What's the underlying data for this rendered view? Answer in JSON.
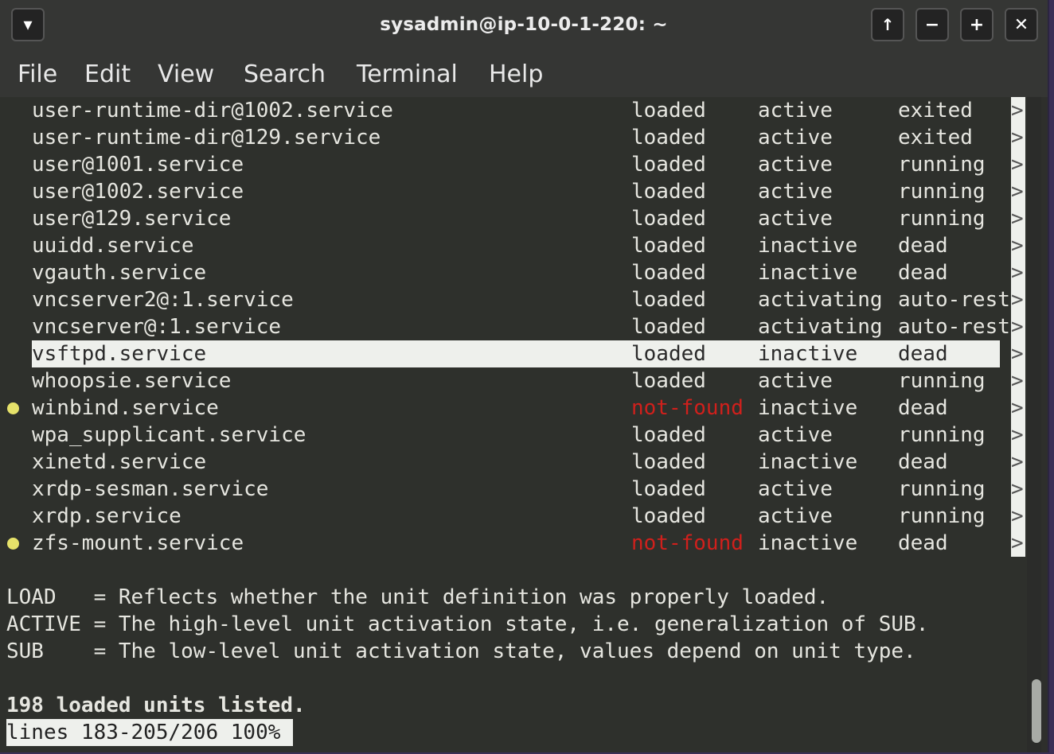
{
  "window": {
    "title": "sysadmin@ip-10-0-1-220: ~",
    "buttons": {
      "menu": "▾",
      "raise": "🡅",
      "minimize": "−",
      "maximize": "+",
      "close": "✕"
    }
  },
  "menubar": [
    "File",
    "Edit",
    "View",
    "Search",
    "Terminal",
    "Help"
  ],
  "units": [
    {
      "name": "user-runtime-dir@1002.service",
      "load": "loaded",
      "active": "active",
      "sub": "exited",
      "warn": false
    },
    {
      "name": "user-runtime-dir@129.service",
      "load": "loaded",
      "active": "active",
      "sub": "exited",
      "warn": false
    },
    {
      "name": "user@1001.service",
      "load": "loaded",
      "active": "active",
      "sub": "running",
      "warn": false
    },
    {
      "name": "user@1002.service",
      "load": "loaded",
      "active": "active",
      "sub": "running",
      "warn": false
    },
    {
      "name": "user@129.service",
      "load": "loaded",
      "active": "active",
      "sub": "running",
      "warn": false
    },
    {
      "name": "uuidd.service",
      "load": "loaded",
      "active": "inactive",
      "sub": "dead",
      "warn": false
    },
    {
      "name": "vgauth.service",
      "load": "loaded",
      "active": "inactive",
      "sub": "dead",
      "warn": false
    },
    {
      "name": "vncserver2@:1.service",
      "load": "loaded",
      "active": "activating",
      "sub": "auto-rest",
      "warn": false
    },
    {
      "name": "vncserver@:1.service",
      "load": "loaded",
      "active": "activating",
      "sub": "auto-rest",
      "warn": false
    },
    {
      "name": "vsftpd.service",
      "load": "loaded",
      "active": "inactive",
      "sub": "dead",
      "warn": false,
      "selected": true
    },
    {
      "name": "whoopsie.service",
      "load": "loaded",
      "active": "active",
      "sub": "running",
      "warn": false
    },
    {
      "name": "winbind.service",
      "load": "not-found",
      "active": "inactive",
      "sub": "dead",
      "warn": true
    },
    {
      "name": "wpa_supplicant.service",
      "load": "loaded",
      "active": "active",
      "sub": "running",
      "warn": false
    },
    {
      "name": "xinetd.service",
      "load": "loaded",
      "active": "inactive",
      "sub": "dead",
      "warn": false
    },
    {
      "name": "xrdp-sesman.service",
      "load": "loaded",
      "active": "active",
      "sub": "running",
      "warn": false
    },
    {
      "name": "xrdp.service",
      "load": "loaded",
      "active": "active",
      "sub": "running",
      "warn": false
    },
    {
      "name": "zfs-mount.service",
      "load": "not-found",
      "active": "inactive",
      "sub": "dead",
      "warn": true
    }
  ],
  "truncation_marker": ">",
  "legend": [
    "LOAD   = Reflects whether the unit definition was properly loaded.",
    "ACTIVE = The high-level unit activation state, i.e. generalization of SUB.",
    "SUB    = The low-level unit activation state, values depend on unit type."
  ],
  "summary": "198 loaded units listed.",
  "pager_status": "lines 183-205/206 100%",
  "colors": {
    "not_found": "#d0201c",
    "warn_bullet": "#e6e26a",
    "terminal_bg": "#2e302c"
  }
}
